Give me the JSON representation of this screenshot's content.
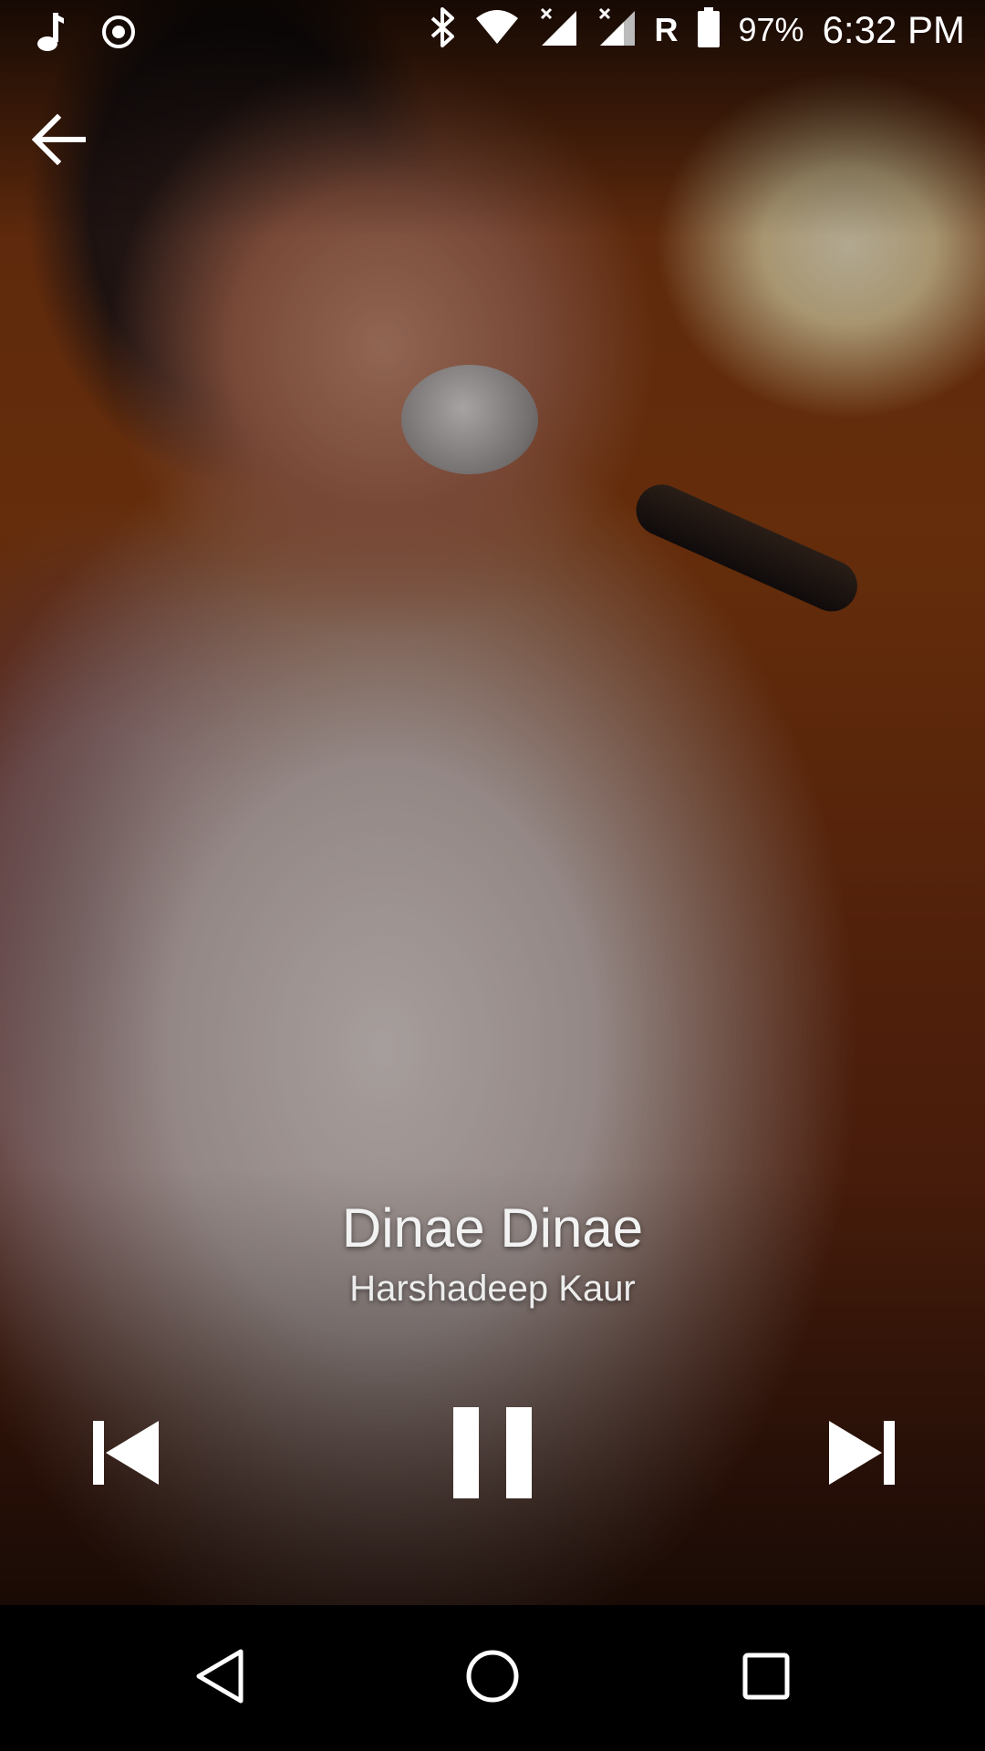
{
  "status_bar": {
    "battery_percent": "97%",
    "time": "6:32 PM",
    "roaming_indicator": "R",
    "icons": [
      "music-note-icon",
      "radio-target-icon",
      "bluetooth-icon",
      "wifi-icon",
      "cell-signal-icon",
      "cell-signal-icon",
      "battery-icon"
    ]
  },
  "toolbar": {
    "back_icon": "arrow-back-icon"
  },
  "now_playing": {
    "title": "Dinae Dinae",
    "artist": "Harshadeep Kaur",
    "is_playing": true
  },
  "controls": {
    "previous_icon": "skip-previous-icon",
    "pause_icon": "pause-icon",
    "next_icon": "skip-next-icon"
  },
  "navigation_bar": {
    "back_icon": "nav-back-icon",
    "home_icon": "nav-home-icon",
    "recents_icon": "nav-recents-icon"
  },
  "colors": {
    "text": "#f2f2f2",
    "background": "#000000",
    "icon": "#ffffff"
  }
}
